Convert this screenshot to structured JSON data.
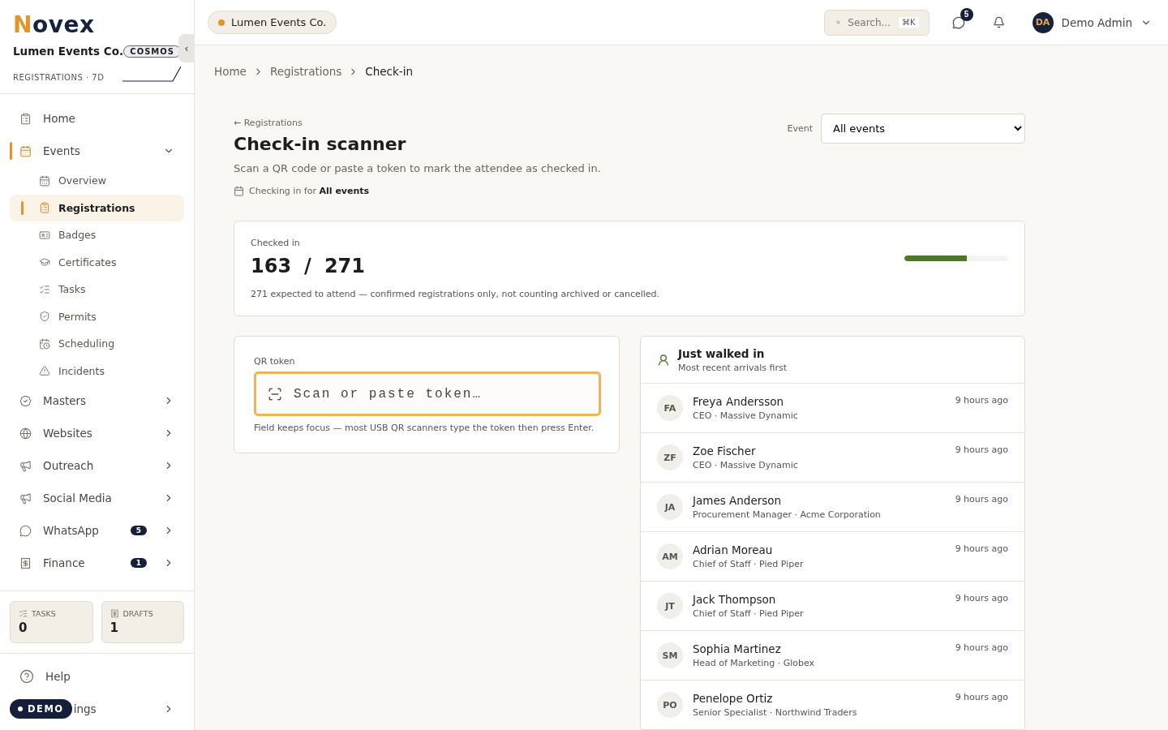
{
  "brand": {
    "logo_initial": "N",
    "logo_rest": "ovex",
    "org": "Lumen Events Co.",
    "plan": "COSMOS",
    "metric_label": "REGISTRATIONS · 7D",
    "collapse_glyph": "‹"
  },
  "nav": [
    {
      "label": "Home",
      "kind": "item",
      "selected": false
    },
    {
      "label": "Events",
      "kind": "group",
      "expanded": true,
      "selected": true,
      "children": [
        {
          "label": "Overview",
          "selected": false
        },
        {
          "label": "Registrations",
          "selected": true
        },
        {
          "label": "Badges",
          "selected": false
        },
        {
          "label": "Certificates",
          "selected": false
        },
        {
          "label": "Tasks",
          "selected": false
        },
        {
          "label": "Permits",
          "selected": false
        },
        {
          "label": "Scheduling",
          "selected": false
        },
        {
          "label": "Incidents",
          "selected": false
        }
      ]
    },
    {
      "label": "Masters",
      "kind": "group",
      "expanded": false,
      "selected": false
    },
    {
      "label": "Websites",
      "kind": "group",
      "expanded": false,
      "selected": false
    },
    {
      "label": "Outreach",
      "kind": "group",
      "expanded": false,
      "selected": false
    },
    {
      "label": "Social Media",
      "kind": "group",
      "expanded": false,
      "selected": false
    },
    {
      "label": "WhatsApp",
      "kind": "group",
      "expanded": false,
      "selected": false,
      "badge": "5"
    },
    {
      "label": "Finance",
      "kind": "group",
      "expanded": false,
      "selected": false,
      "badge": "1"
    }
  ],
  "counters": [
    {
      "label": "TASKS",
      "value": "0"
    },
    {
      "label": "DRAFTS",
      "value": "1"
    }
  ],
  "footer_nav": [
    {
      "label": "Help"
    },
    {
      "label": "ings"
    }
  ],
  "demo_badge": "DEMO",
  "topbar": {
    "org_chip": "Lumen Events Co.",
    "search_placeholder": "Search...",
    "search_shortcut": "⌘K",
    "messages_count": "5",
    "user_initials": "DA",
    "user_name": "Demo Admin"
  },
  "breadcrumbs": [
    {
      "label": "Home",
      "current": false
    },
    {
      "label": "Registrations",
      "current": false
    },
    {
      "label": "Check-in",
      "current": true
    }
  ],
  "header": {
    "back_link": "← Registrations",
    "title": "Check-in scanner",
    "subtitle": "Scan a QR code or paste a token to mark the attendee as checked in.",
    "scope_prefix": "Checking in for ",
    "scope_value": "All events",
    "event_label": "Event",
    "event_value": "All events"
  },
  "stats": {
    "label": "Checked in",
    "checked": "163",
    "separator": "/",
    "total": "271",
    "level": 0.6,
    "note": "271 expected to attend — confirmed registrations only, not counting archived or cancelled."
  },
  "scanner": {
    "label": "QR token",
    "placeholder": "Scan or paste token…",
    "hint": "Field keeps focus — most USB QR scanners type the token then press Enter.",
    "focused": true
  },
  "arrivals": {
    "title": "Just walked in",
    "subtitle": "Most recent arrivals first",
    "items": [
      {
        "initials": "FA",
        "name": "Freya Andersson",
        "role": "CEO · Massive Dynamic",
        "time": "9 hours ago"
      },
      {
        "initials": "ZF",
        "name": "Zoe Fischer",
        "role": "CEO · Massive Dynamic",
        "time": "9 hours ago"
      },
      {
        "initials": "JA",
        "name": "James Anderson",
        "role": "Procurement Manager · Acme Corporation",
        "time": "9 hours ago"
      },
      {
        "initials": "AM",
        "name": "Adrian Moreau",
        "role": "Chief of Staff · Pied Piper",
        "time": "9 hours ago"
      },
      {
        "initials": "JT",
        "name": "Jack Thompson",
        "role": "Chief of Staff · Pied Piper",
        "time": "9 hours ago"
      },
      {
        "initials": "SM",
        "name": "Sophia Martinez",
        "role": "Head of Marketing · Globex",
        "time": "9 hours ago"
      },
      {
        "initials": "PO",
        "name": "Penelope Ortiz",
        "role": "Senior Specialist · Northwind Traders",
        "time": "9 hours ago"
      }
    ]
  }
}
